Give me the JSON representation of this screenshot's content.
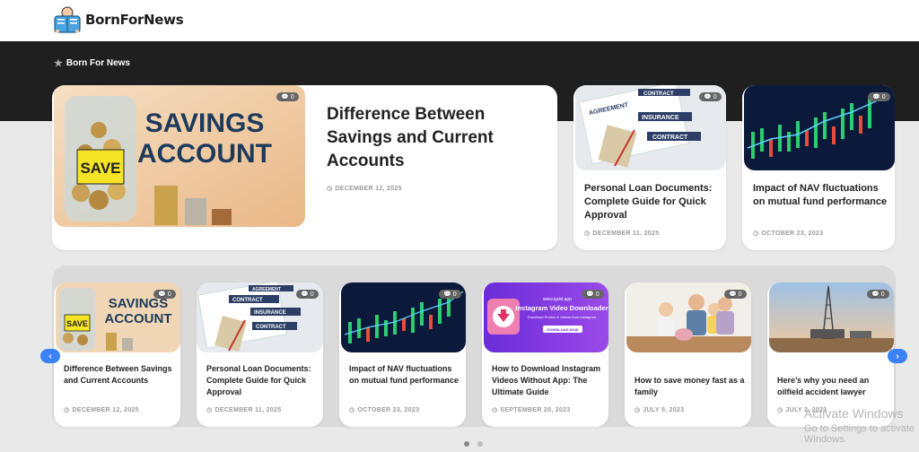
{
  "site": {
    "logo_text": "BornForNews",
    "breadcrumb": "Born For News"
  },
  "featured": {
    "title": "Difference Between Savings and Current Accounts",
    "date": "DECEMBER 12, 2025",
    "comments": "0",
    "image_label_line1": "SAVINGS",
    "image_label_line2": "ACCOUNT",
    "image_label_jar": "SAVE"
  },
  "side_cards": [
    {
      "title": "Personal Loan Documents: Complete Guide for Quick Approval",
      "date": "DECEMBER 11, 2025",
      "comments": "0"
    },
    {
      "title": "Impact of NAV fluctuations on mutual fund performance",
      "date": "OCTOBER 23, 2023",
      "comments": "0"
    }
  ],
  "carousel": [
    {
      "title": "Difference Between Savings and Current Accounts",
      "date": "DECEMBER 12, 2025",
      "comments": "0"
    },
    {
      "title": "Personal Loan Documents: Complete Guide for Quick Approval",
      "date": "DECEMBER 11, 2025",
      "comments": "0"
    },
    {
      "title": "Impact of NAV fluctuations on mutual fund performance",
      "date": "OCTOBER 23, 2023",
      "comments": "0"
    },
    {
      "title": "How to Download Instagram Videos Without App: The Ultimate Guide",
      "date": "SEPTEMBER 20, 2023",
      "comments": "0"
    },
    {
      "title": "How to save money fast as a family",
      "date": "JULY 5, 2023",
      "comments": "0"
    },
    {
      "title": "Here’s why you need an oilfield accident lawyer",
      "date": "JULY 2, 2023",
      "comments": "0"
    }
  ],
  "image_text": {
    "contract_1": "AGREEMENT",
    "contract_2": "CONTRACT",
    "contract_3": "INSURANCE",
    "contract_4": "CONTRACT",
    "insta_site": "www.igvid.app",
    "insta_title": "Instagram Video Downloader",
    "insta_sub": "Download Photos & Videos from Instagram",
    "insta_btn": "DOWNLOAD NOW"
  },
  "watermark": {
    "line1": "Activate Windows",
    "line2": "Go to Settings to activate Windows."
  },
  "colors": {
    "accent": "#3b82f6",
    "dark_band": "#1f1f1f",
    "dot_active": "#888888",
    "dot_inactive": "#bdbdbd"
  }
}
